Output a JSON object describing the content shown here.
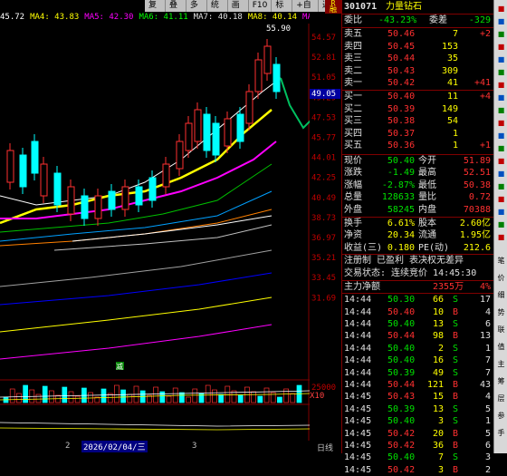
{
  "menu": [
    "复权",
    "叠加",
    "多股",
    "统计",
    "画线",
    "F10",
    "标记",
    "+自选",
    "返回"
  ],
  "ma_labels": [
    {
      "label": "45.72",
      "color": "#ffffff"
    },
    {
      "label": "MA4: 43.83",
      "color": "#ffff00"
    },
    {
      "label": "MA5: 42.30",
      "color": "#ff00ff"
    },
    {
      "label": "MA6: 41.11",
      "color": "#00ff00"
    },
    {
      "label": "MA7: 40.18",
      "color": "#e0e0e0"
    },
    {
      "label": "MA8: 40.14",
      "color": "#ffff00"
    },
    {
      "label": "MA9: 40.93",
      "color": "#ff00ff"
    }
  ],
  "high_marker": "55.90",
  "current_price_tag": "49.05",
  "y_ticks": [
    "54.57",
    "52.81",
    "51.05",
    "49.29",
    "47.53",
    "45.77",
    "44.01",
    "42.25",
    "40.49",
    "38.73",
    "36.97",
    "35.21",
    "33.45",
    "31.69"
  ],
  "volume_tick": "25000",
  "volume_unit": "X10",
  "reduce_marker": "减",
  "bottom": {
    "left_label": "2",
    "date": "2026/02/04/三",
    "mid_label": "3",
    "period": "日线"
  },
  "stock": {
    "code": "301071",
    "name": "力量钻石",
    "tag_top": "R",
    "tag_bottom": "融"
  },
  "weibi": {
    "label": "委比",
    "value": "-43.23%",
    "label2": "委差",
    "value2": "-329"
  },
  "asks": [
    {
      "label": "卖五",
      "price": "50.46",
      "vol": "7",
      "chg": "+2"
    },
    {
      "label": "卖四",
      "price": "50.45",
      "vol": "153",
      "chg": ""
    },
    {
      "label": "卖三",
      "price": "50.44",
      "vol": "35",
      "chg": ""
    },
    {
      "label": "卖二",
      "price": "50.43",
      "vol": "309",
      "chg": ""
    },
    {
      "label": "卖一",
      "price": "50.42",
      "vol": "41",
      "chg": "+41"
    }
  ],
  "bids": [
    {
      "label": "买一",
      "price": "50.40",
      "vol": "11",
      "chg": "+4"
    },
    {
      "label": "买二",
      "price": "50.39",
      "vol": "149",
      "chg": ""
    },
    {
      "label": "买三",
      "price": "50.38",
      "vol": "54",
      "chg": ""
    },
    {
      "label": "买四",
      "price": "50.37",
      "vol": "1",
      "chg": ""
    },
    {
      "label": "买五",
      "price": "50.36",
      "vol": "1",
      "chg": "+1"
    }
  ],
  "quote": [
    {
      "l1": "现价",
      "v1": "50.40",
      "l2": "今开",
      "v2": "51.89"
    },
    {
      "l1": "涨跌",
      "v1": "-1.49",
      "l2": "最高",
      "v2": "52.51"
    },
    {
      "l1": "涨幅",
      "v1": "-2.87%",
      "l2": "最低",
      "v2": "50.38"
    },
    {
      "l1": "总量",
      "v1": "128633",
      "l2": "量比",
      "v2": "0.72"
    },
    {
      "l1": "外盘",
      "v1": "58245",
      "l2": "内盘",
      "v2": "70388"
    }
  ],
  "fund": [
    {
      "l1": "换手",
      "v1": "6.61%",
      "l2": "股本",
      "v2": "2.60亿"
    },
    {
      "l1": "净资",
      "v1": "20.34",
      "l2": "流通",
      "v2": "1.95亿"
    },
    {
      "l1": "收益(三)",
      "v1": "0.180",
      "l2": "PE(动)",
      "v2": "212.6"
    }
  ],
  "reg_info": "注册制 已盈利 表决权无差异",
  "trade_status": "交易状态: 连续竞价 14:45:30",
  "main_flow": {
    "label": "主力净额",
    "value": "2355万",
    "pct": "4%"
  },
  "ticks": [
    {
      "t": "14:44",
      "p": "50.30",
      "v": "66",
      "s": "S",
      "n": "17"
    },
    {
      "t": "14:44",
      "p": "50.40",
      "v": "10",
      "s": "B",
      "n": "4"
    },
    {
      "t": "14:44",
      "p": "50.40",
      "v": "13",
      "s": "S",
      "n": "6"
    },
    {
      "t": "14:44",
      "p": "50.44",
      "v": "98",
      "s": "B",
      "n": "13"
    },
    {
      "t": "14:44",
      "p": "50.40",
      "v": "2",
      "s": "S",
      "n": "1"
    },
    {
      "t": "14:44",
      "p": "50.40",
      "v": "16",
      "s": "S",
      "n": "7"
    },
    {
      "t": "14:44",
      "p": "50.39",
      "v": "49",
      "s": "S",
      "n": "7"
    },
    {
      "t": "14:44",
      "p": "50.44",
      "v": "121",
      "s": "B",
      "n": "43"
    },
    {
      "t": "14:45",
      "p": "50.43",
      "v": "15",
      "s": "B",
      "n": "4"
    },
    {
      "t": "14:45",
      "p": "50.39",
      "v": "13",
      "s": "S",
      "n": "5"
    },
    {
      "t": "14:45",
      "p": "50.40",
      "v": "3",
      "s": "S",
      "n": "1"
    },
    {
      "t": "14:45",
      "p": "50.42",
      "v": "20",
      "s": "B",
      "n": "5"
    },
    {
      "t": "14:45",
      "p": "50.42",
      "v": "36",
      "s": "B",
      "n": "6"
    },
    {
      "t": "14:45",
      "p": "50.40",
      "v": "7",
      "s": "S",
      "n": "3"
    },
    {
      "t": "14:45",
      "p": "50.42",
      "v": "3",
      "s": "B",
      "n": "2"
    }
  ],
  "toolbar_icons": [
    "gear-icon",
    "compass-icon",
    "tile-icon",
    "grid-icon",
    "bar-icon",
    "list-icon",
    "cross-icon",
    "chart-icon",
    "group-icon",
    "target-icon",
    "menu-icon",
    "doc-icon",
    "box-icon",
    "flag-icon",
    "tag-icon",
    "window-icon",
    "link-icon",
    "star-icon",
    "bell-icon"
  ],
  "toolbar_text": [
    "笔",
    "价",
    "细",
    "势",
    "联",
    "值",
    "主",
    "筹",
    "层",
    "参",
    "手"
  ]
}
